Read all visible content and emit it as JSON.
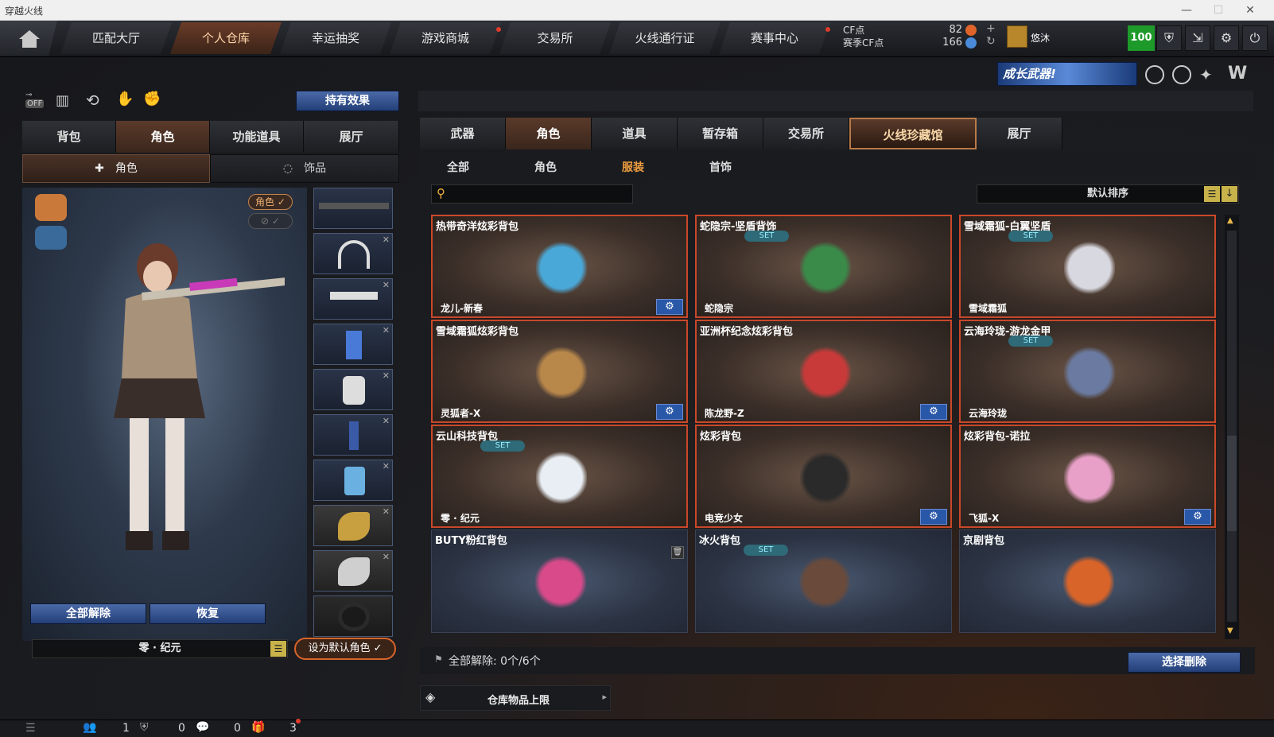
{
  "window": {
    "title": "穿越火线"
  },
  "nav": {
    "tabs": [
      "匹配大厅",
      "个人仓库",
      "幸运抽奖",
      "游戏商城",
      "交易所",
      "火线通行证",
      "赛事中心"
    ]
  },
  "currency": {
    "cf_label": "CF点",
    "season_label": "赛季CF点",
    "cf_value": "82",
    "season_value": "166"
  },
  "user": {
    "name": "悠沐",
    "level": "100"
  },
  "banner": {
    "text": "成长武器!"
  },
  "left": {
    "hold_effect": "持有效果",
    "tabs": [
      "背包",
      "角色",
      "功能道具",
      "展厅"
    ],
    "subtabs": [
      "角色",
      "饰品"
    ],
    "char_badge": "角色",
    "unequip_all": "全部解除",
    "restore": "恢复",
    "char_name": "零 · 纪元",
    "set_default": "设为默认角色"
  },
  "right": {
    "tabs": [
      "武器",
      "角色",
      "道具",
      "暂存箱",
      "交易所",
      "火线珍藏馆",
      "展厅"
    ],
    "subtabs": [
      "全部",
      "角色",
      "服装",
      "首饰"
    ],
    "search_placeholder": "",
    "sort": "默认排序",
    "unequip_status": "全部解除: 0个/6个",
    "select_delete": "选择删除",
    "storage_limit": "仓库物品上限"
  },
  "items": [
    {
      "name": "热带奇洋炫彩背包",
      "owner": "龙儿-新春",
      "set": false,
      "gear": true,
      "style": "red",
      "color": "#4aa8d8"
    },
    {
      "name": "蛇隐宗-坚盾背饰",
      "owner": "蛇隐宗",
      "set": true,
      "gear": false,
      "style": "red",
      "color": "#3a8a4a"
    },
    {
      "name": "雪域霜狐-白翼坚盾",
      "owner": "雪域霜狐",
      "set": true,
      "gear": false,
      "style": "red",
      "color": "#d8d8e0"
    },
    {
      "name": "雪域霜狐炫彩背包",
      "owner": "灵狐者-X",
      "set": false,
      "gear": true,
      "style": "red",
      "color": "#b8874a"
    },
    {
      "name": "亚洲杯纪念炫彩背包",
      "owner": "陈龙野-Z",
      "set": false,
      "gear": true,
      "style": "red",
      "color": "#c83a3a"
    },
    {
      "name": "云海玲珑-游龙金甲",
      "owner": "云海玲珑",
      "set": true,
      "gear": false,
      "style": "red",
      "color": "#6a7aa0"
    },
    {
      "name": "云山科技背包",
      "owner": "零 · 纪元",
      "set": true,
      "gear": false,
      "style": "red",
      "color": "#e8eef4"
    },
    {
      "name": "炫彩背包",
      "owner": "电竞少女",
      "set": false,
      "gear": true,
      "style": "red",
      "color": "#2a2a2a"
    },
    {
      "name": "炫彩背包-诺拉",
      "owner": "飞狐-X",
      "set": false,
      "gear": true,
      "style": "red",
      "color": "#e8a0c8"
    },
    {
      "name": "BUTY粉红背包",
      "owner": "",
      "set": false,
      "gear": false,
      "style": "blue",
      "color": "#d84a8a"
    },
    {
      "name": "冰火背包",
      "owner": "",
      "set": true,
      "gear": false,
      "style": "blue",
      "color": "#6a4a3a"
    },
    {
      "name": "京剧背包",
      "owner": "",
      "set": false,
      "gear": false,
      "style": "blue",
      "color": "#d8642a"
    }
  ],
  "bottom": {
    "count1": "1",
    "count2": "0",
    "count3": "0",
    "count4": "3"
  },
  "set_label": "SET"
}
